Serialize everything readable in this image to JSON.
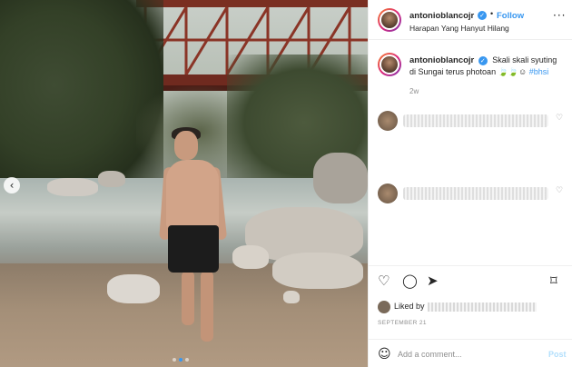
{
  "post": {
    "username": "antonioblancojr",
    "verified_glyph": "✓",
    "separator": "•",
    "follow_label": "Follow",
    "location": "Harapan Yang Hanyut Hilang",
    "more_glyph": "···"
  },
  "caption": {
    "username": "antonioblancojr",
    "text": "Skali skali syuting di Sungai terus photoan 🍃🍃☺",
    "hashtag": "#bhsi",
    "time": "2w"
  },
  "comments": [
    {
      "avatar": "blurred-avatar",
      "text_blurred": true
    },
    {
      "avatar": "blurred-avatar",
      "text_blurred": true
    }
  ],
  "actions": {
    "like_icon": "♡",
    "comment_icon": "◯",
    "share_icon": "➤",
    "save_icon": "⌑"
  },
  "likes": {
    "prefix": "Liked by"
  },
  "date": "SEPTEMBER 21",
  "add_comment": {
    "placeholder": "Add a comment...",
    "post_label": "Post",
    "emoji_icon": "☺"
  },
  "photo": {
    "prev_arrow": "‹",
    "slide_count": 3,
    "active_slide": 2
  },
  "colors": {
    "accent": "#3897f0",
    "post_disabled": "#b2dffc",
    "muted": "#8e8e8e",
    "text": "#262626"
  }
}
